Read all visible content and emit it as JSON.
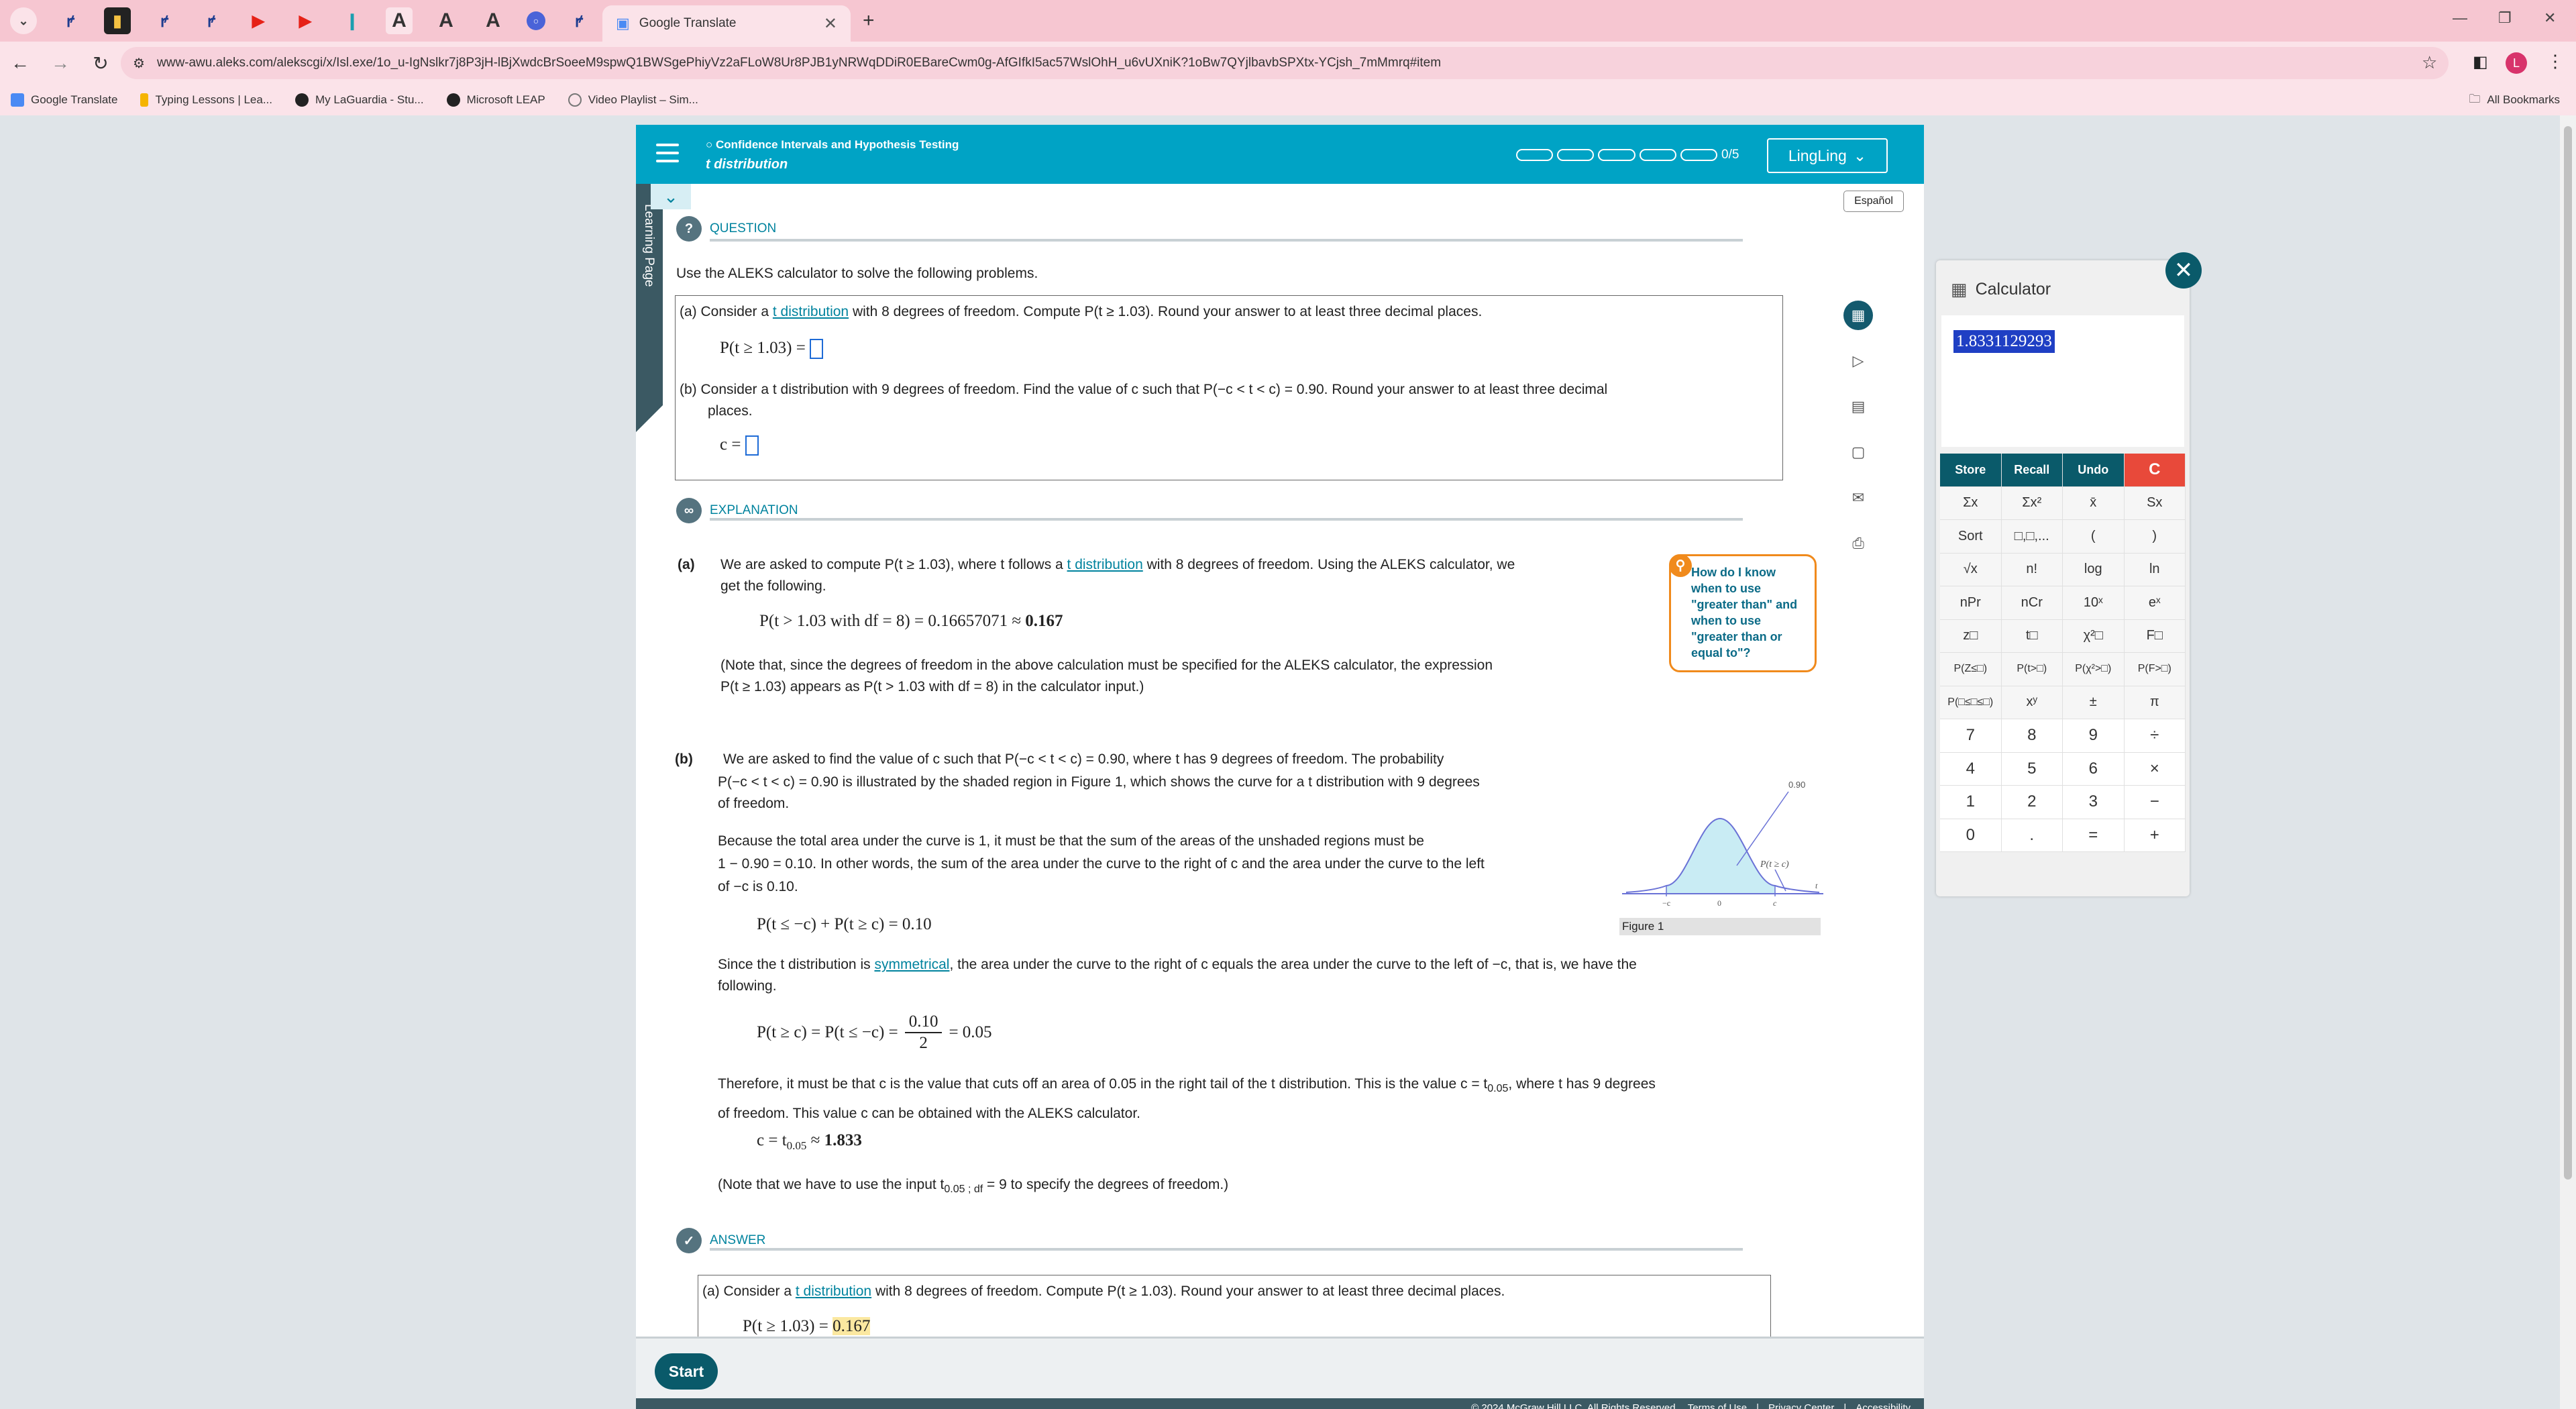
{
  "browser": {
    "active_tab_title": "Google Translate",
    "url": "www-awu.aleks.com/alekscgi/x/Isl.exe/1o_u-IgNslkr7j8P3jH-lBjXwdcBrSoeeM9spwQ1BWSgePhiyVz2aFLoW8Ur8PJB1yNRWqDDiR0EBareCwm0g-AfGIfkI5ac57WslOhH_u6vUXniK?1oBw7QYjlbavbSPXtx-YCjsh_7mMmrq#item",
    "bookmarks": [
      "Google Translate",
      "Typing Lessons | Lea...",
      "My LaGuardia - Stu...",
      "Microsoft LEAP",
      "Video Playlist – Sim..."
    ],
    "all_bookmarks": "All Bookmarks"
  },
  "header": {
    "topic": "Confidence Intervals and Hypothesis Testing",
    "subtopic": "t distribution",
    "progress": "0/5",
    "user": "LingLing"
  },
  "sidebar_tab": "Learning Page",
  "espanol": "Español",
  "question": {
    "heading": "QUESTION",
    "intro": "Use the ALEKS calculator to solve the following problems.",
    "a_pre": "(a)  Consider a ",
    "a_link": "t distribution",
    "a_post": " with 8 degrees of freedom. Compute P(t ≥ 1.03). Round your answer to at least three decimal places.",
    "a_expr": "P(t ≥ 1.03) =",
    "b_text": "(b)  Consider a t distribution with 9 degrees of freedom. Find the value of c such that P(−c < t < c) = 0.90. Round your answer to at least three decimal",
    "b_text2": "places.",
    "b_expr": "c ="
  },
  "explanation": {
    "heading": "EXPLANATION",
    "a_label": "(a)",
    "a_line1_pre": "We are asked to compute P(t ≥ 1.03), where t follows a ",
    "a_link": "t distribution",
    "a_line1_post": " with 8 degrees of freedom. Using the ALEKS calculator, we",
    "a_line2": "get the following.",
    "a_math": "P(t > 1.03 with df  = 8) = 0.16657071  ≈ ",
    "a_math_bold": "0.167",
    "a_note1": "(Note that, since the degrees of freedom in the above calculation must be specified for the ALEKS calculator, the expression",
    "a_note2": "P(t ≥ 1.03) appears as P(t > 1.03 with df  = 8) in the calculator input.)",
    "tip": "How do I know when to use \"greater than\" and when to use \"greater than or equal to\"?",
    "b_label": "(b)",
    "b_p1": "We are asked to find the value of c such that P(−c < t < c) = 0.90, where t has 9 degrees of freedom. The probability",
    "b_p2": "P(−c < t < c) = 0.90 is illustrated by the shaded region in Figure 1, which shows the curve for a t distribution with 9 degrees",
    "b_p3": "of freedom.",
    "b_p4": "Because the total area under the curve is 1, it must be that the sum of the areas of the unshaded regions must be",
    "b_p5": "1 − 0.90 = 0.10. In other words, the sum of the area under the curve to the right of c and the area under the curve to the left",
    "b_p6": "of −c is 0.10.",
    "b_math1": "P(t ≤ −c) + P(t ≥ c) = 0.10",
    "b_p7_pre": "Since the t distribution is ",
    "b_p7_link": "symmetrical",
    "b_p7_post": ", the area under the curve to the right of c equals the area under the curve to the left of −c, that is, we have the",
    "b_p8": "following.",
    "b_math2_left": "P(t ≥ c) = P(t ≤ −c) =",
    "b_math2_num": "0.10",
    "b_math2_den": "2",
    "b_math2_right": "= 0.05",
    "b_p9": "Therefore, it must be that c is the value that cuts off an area of 0.05 in the right tail of the t distribution. This is the value c = t",
    "b_p9_sub": "0.05",
    "b_p9_post": ", where t has 9 degrees",
    "b_p10": "of freedom. This value c can be obtained with the ALEKS calculator.",
    "b_math3": "c = t",
    "b_math3_sub": "0.05",
    "b_math3_post": " ≈ ",
    "b_math3_bold": "1.833",
    "b_note_pre": "(Note that we have to use the input t",
    "b_note_sub": "0.05 ; df",
    "b_note_post": " = 9 to specify the degrees of freedom.)",
    "figure_caption": "Figure 1",
    "figure_labels": {
      "area": "0.90",
      "tail": "P(t ≥ c)",
      "neg_c": "−c",
      "zero": "0",
      "c": "c",
      "t": "t"
    }
  },
  "answer": {
    "heading": "ANSWER",
    "a_pre": "(a)  Consider a ",
    "a_link": "t distribution",
    "a_post": " with 8 degrees of freedom. Compute P(t ≥ 1.03). Round your answer to at least three decimal places.",
    "a_expr": "P(t ≥ 1.03) = ",
    "a_value": "0.167"
  },
  "start_button": "Start",
  "footer": {
    "copyright": "© 2024 McGraw Hill LLC. All Rights Reserved.",
    "terms": "Terms of Use",
    "privacy": "Privacy Center",
    "accessibility": "Accessibility"
  },
  "calculator": {
    "title": "Calculator",
    "display": "1.8331129293",
    "keys": [
      "Store",
      "Recall",
      "Undo",
      "C",
      "Σx",
      "Σx²",
      "x̄",
      "Sx",
      "Sort",
      "□,□,...",
      "(",
      ")",
      "√x",
      "n!",
      "log",
      "ln",
      "nPr",
      "nCr",
      "10ˣ",
      "eˣ",
      "z□",
      "t□",
      "χ²□",
      "F□",
      "P(Z≤□)",
      "P(t>□)",
      "P(χ²>□)",
      "P(F>□)",
      "P(□≤□≤□)",
      "xʸ",
      "±",
      "π",
      "7",
      "8",
      "9",
      "÷",
      "4",
      "5",
      "6",
      "×",
      "1",
      "2",
      "3",
      "−",
      "0",
      ".",
      "=",
      "+"
    ]
  },
  "colors": {
    "teal": "#00a3c5",
    "dark_teal": "#0a5a6a",
    "clear_red": "#e8493a",
    "tab_bg": "#f6c6d1",
    "tip_border": "#f08a1c"
  }
}
